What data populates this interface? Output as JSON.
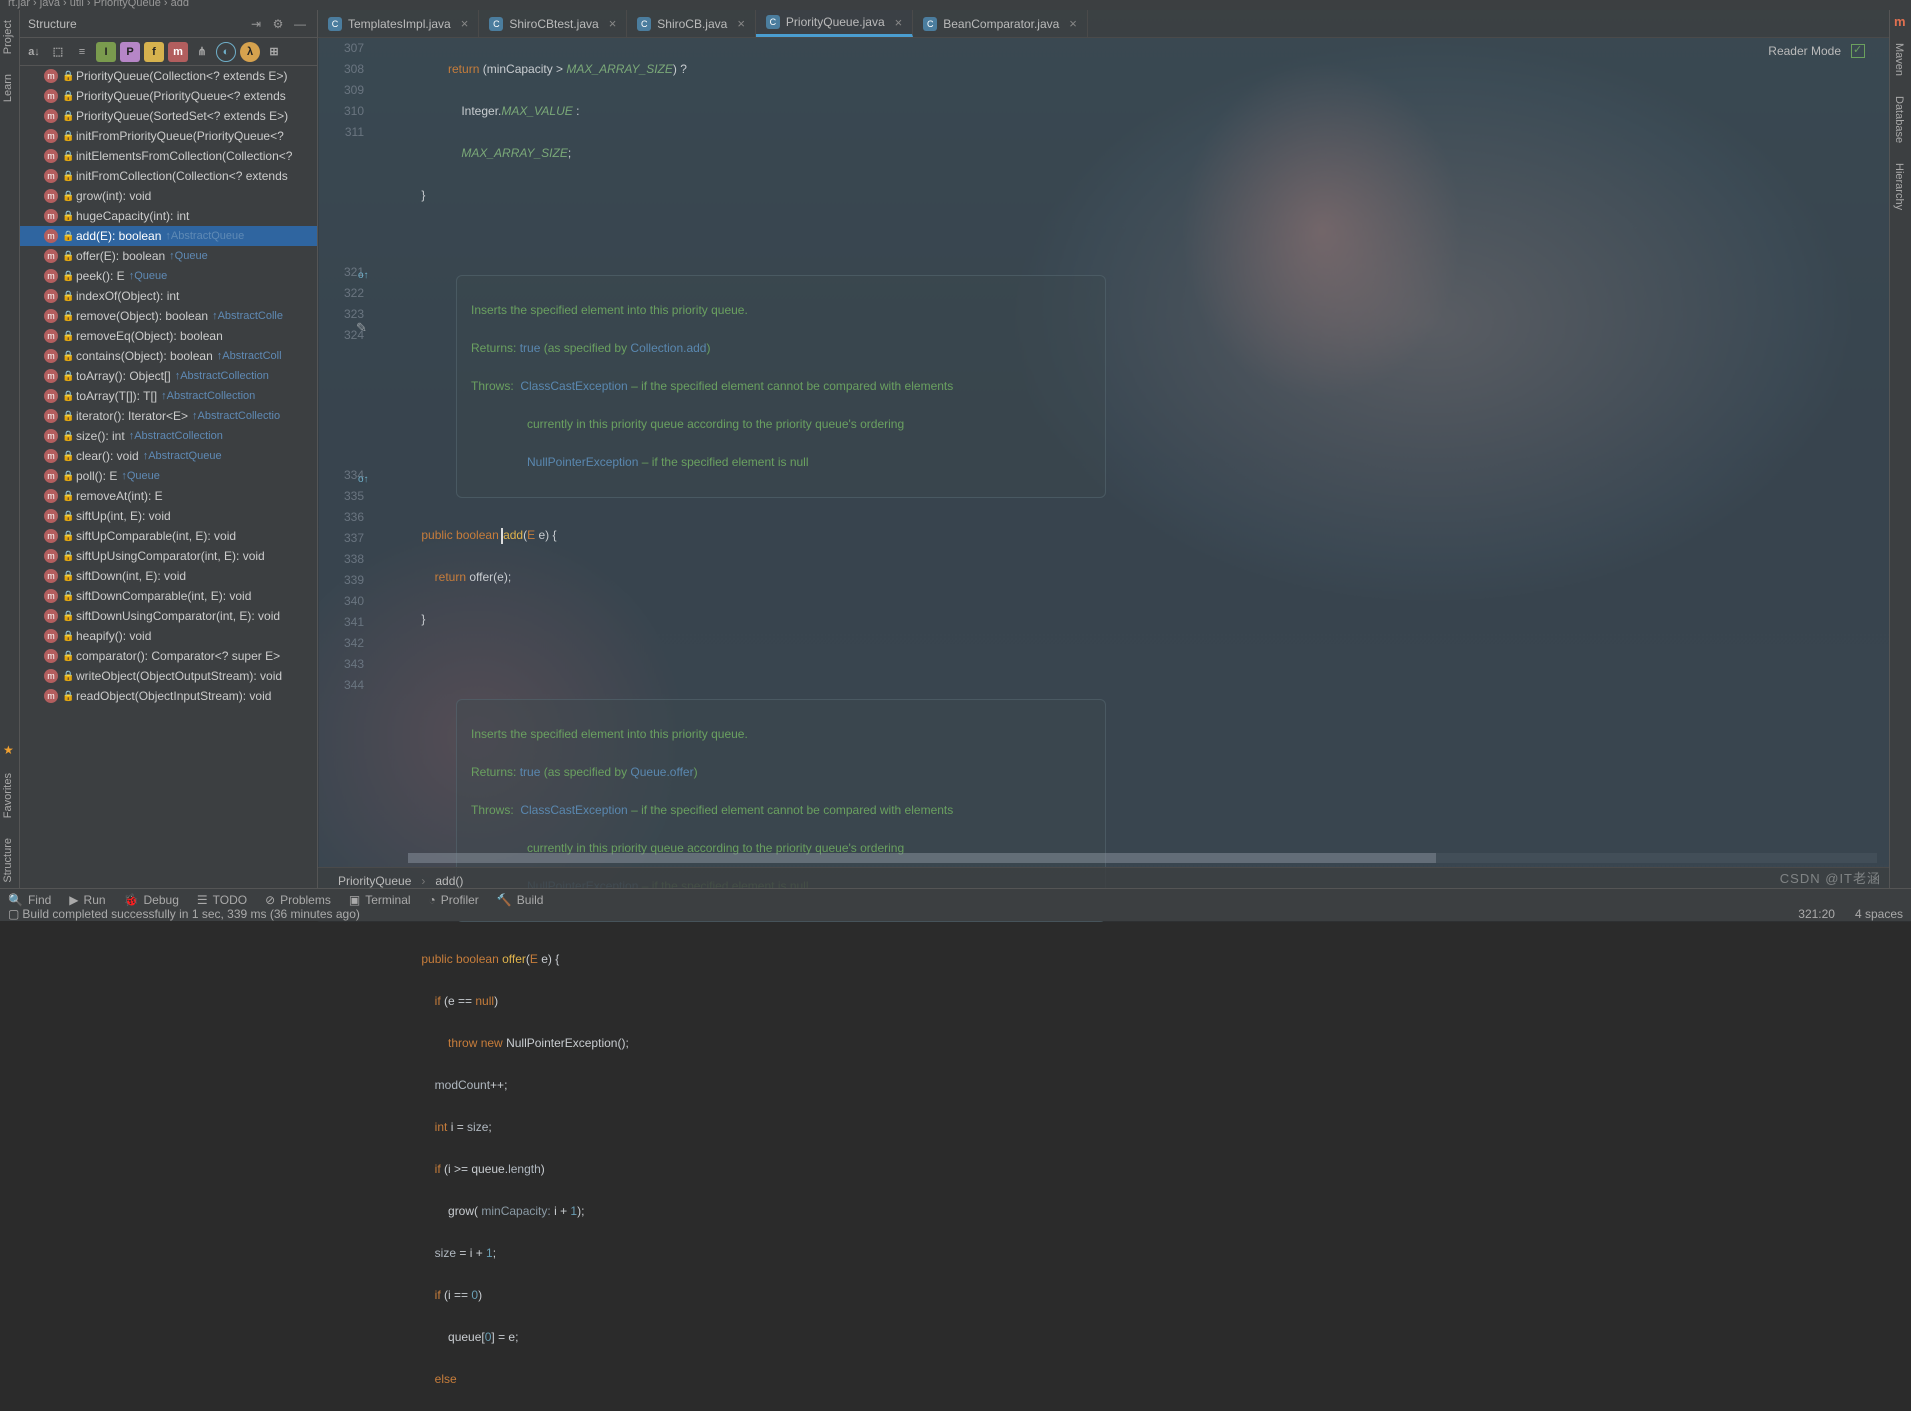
{
  "breadcrumb_top": "rt.jar › java › util › PriorityQueue › add",
  "structure_title": "Structure",
  "left_rail": {
    "project": "Project",
    "learn": "Learn",
    "favorites": "Favorites",
    "structure": "Structure"
  },
  "right_rail": {
    "maven": "Maven",
    "database": "Database",
    "hierarchy": "Hierarchy"
  },
  "tabs": [
    {
      "label": "TemplatesImpl.java",
      "kind": "class"
    },
    {
      "label": "ShiroCBtest.java",
      "kind": "class"
    },
    {
      "label": "ShiroCB.java",
      "kind": "class"
    },
    {
      "label": "PriorityQueue.java",
      "kind": "class",
      "active": true
    },
    {
      "label": "BeanComparator.java",
      "kind": "class"
    }
  ],
  "reader_mode": "Reader Mode",
  "tree": [
    {
      "t": "PriorityQueue(Collection<? extends E>)",
      "lock": true
    },
    {
      "t": "PriorityQueue(PriorityQueue<? extends",
      "lock": true
    },
    {
      "t": "PriorityQueue(SortedSet<? extends E>)",
      "lock": true
    },
    {
      "t": "initFromPriorityQueue(PriorityQueue<?",
      "lock": true
    },
    {
      "t": "initElementsFromCollection(Collection<?",
      "lock": true
    },
    {
      "t": "initFromCollection(Collection<? extends",
      "lock": true
    },
    {
      "t": "grow(int): void",
      "lock": true
    },
    {
      "t": "hugeCapacity(int): int",
      "lock": true
    },
    {
      "t": "add(E): boolean",
      "lock": true,
      "ovr": "↑AbstractQueue",
      "sel": true
    },
    {
      "t": "offer(E): boolean",
      "lock": true,
      "ovr": "↑Queue"
    },
    {
      "t": "peek(): E",
      "lock": true,
      "ovr": "↑Queue"
    },
    {
      "t": "indexOf(Object): int",
      "lock": true
    },
    {
      "t": "remove(Object): boolean",
      "lock": true,
      "ovr": "↑AbstractColle"
    },
    {
      "t": "removeEq(Object): boolean",
      "lock": true
    },
    {
      "t": "contains(Object): boolean",
      "lock": true,
      "ovr": "↑AbstractColl"
    },
    {
      "t": "toArray(): Object[]",
      "lock": true,
      "ovr": "↑AbstractCollection"
    },
    {
      "t": "toArray(T[]): T[]",
      "lock": true,
      "ovr": "↑AbstractCollection"
    },
    {
      "t": "iterator(): Iterator<E>",
      "lock": true,
      "ovr": "↑AbstractCollectio"
    },
    {
      "t": "size(): int",
      "lock": true,
      "ovr": "↑AbstractCollection"
    },
    {
      "t": "clear(): void",
      "lock": true,
      "ovr": "↑AbstractQueue"
    },
    {
      "t": "poll(): E",
      "lock": true,
      "ovr": "↑Queue"
    },
    {
      "t": "removeAt(int): E",
      "lock": true
    },
    {
      "t": "siftUp(int, E): void",
      "lock": true
    },
    {
      "t": "siftUpComparable(int, E): void",
      "lock": true
    },
    {
      "t": "siftUpUsingComparator(int, E): void",
      "lock": true
    },
    {
      "t": "siftDown(int, E): void",
      "lock": true
    },
    {
      "t": "siftDownComparable(int, E): void",
      "lock": true
    },
    {
      "t": "siftDownUsingComparator(int, E): void",
      "lock": true
    },
    {
      "t": "heapify(): void",
      "lock": true
    },
    {
      "t": "comparator(): Comparator<? super E>",
      "lock": true
    },
    {
      "t": "writeObject(ObjectOutputStream): void",
      "lock": true
    },
    {
      "t": "readObject(ObjectInputStream): void",
      "lock": true
    }
  ],
  "line_numbers": [
    "307",
    "308",
    "309",
    "310",
    "311",
    "",
    "",
    "",
    "",
    "",
    "",
    "321",
    "322",
    "323",
    "324",
    "",
    "",
    "",
    "",
    "",
    "",
    "334",
    "335",
    "336",
    "337",
    "338",
    "339",
    "340",
    "341",
    "342",
    "343",
    "344",
    ""
  ],
  "doc1": {
    "l1": "Inserts the specified element into this priority queue.",
    "ret": "Returns: ",
    "ret_v": "true",
    "ret_t": " (as specified by ",
    "ret_link": "Collection.add",
    "ret_e": ")",
    "thr": "Throws:  ",
    "e1": "ClassCastException",
    "e1t": " – if the specified element cannot be compared with elements",
    "e1t2": "currently in this priority queue according to the priority queue's ordering",
    "e2": "NullPointerException",
    "e2t": " – if the specified element is null"
  },
  "doc2": {
    "l1": "Inserts the specified element into this priority queue.",
    "ret": "Returns: ",
    "ret_v": "true",
    "ret_t": " (as specified by ",
    "ret_link": "Queue.offer",
    "ret_e": ")",
    "thr": "Throws:  ",
    "e1": "ClassCastException",
    "e1t": " – if the specified element cannot be compared with elements",
    "e1t2": "currently in this priority queue according to the priority queue's ordering",
    "e2": "NullPointerException",
    "e2t": " – if the specified element is null"
  },
  "code": {
    "l307a": "return ",
    "l307b": "(minCapacity > ",
    "l307c": "MAX_ARRAY_SIZE",
    "l307d": ") ?",
    "l308a": "Integer.",
    "l308b": "MAX_VALUE",
    "l308c": " :",
    "l309a": "MAX_ARRAY_SIZE",
    "l309b": ";",
    "l310": "}",
    "l321a": "public ",
    "l321b": "boolean ",
    "l321c": "add",
    "l321d": "(",
    "l321e": "E ",
    "l321f": "e) {",
    "l322a": "return ",
    "l322b": "offer(e);",
    "l323": "}",
    "l334a": "public ",
    "l334b": "boolean ",
    "l334c": "offer",
    "l334d": "(",
    "l334e": "E ",
    "l334f": "e) {",
    "l335a": "if ",
    "l335b": "(e == ",
    "l335c": "null",
    "l335d": ")",
    "l336a": "throw ",
    "l336b": "new ",
    "l336c": "NullPointerException();",
    "l337a": "modCount",
    "l337b": "++;",
    "l338a": "int ",
    "l338b": "i = ",
    "l338c": "size",
    "l338d": ";",
    "l339a": "if ",
    "l339b": "(i >= queue.",
    "l339c": "length",
    "l339d": ")",
    "l340a": "grow( ",
    "l340h": "minCapacity: ",
    "l340b": "i + ",
    "l340c": "1",
    "l340d": ");",
    "l341a": "size ",
    "l341b": "= i + ",
    "l341c": "1",
    "l341d": ";",
    "l342a": "if ",
    "l342b": "(i == ",
    "l342c": "0",
    "l342d": ")",
    "l343a": "queue[",
    "l343b": "0",
    "l343c": "] = e;",
    "l344": "else"
  },
  "bread2": {
    "a": "PriorityQueue",
    "b": "add()"
  },
  "bottom": {
    "find": "Find",
    "run": "Run",
    "debug": "Debug",
    "todo": "TODO",
    "problems": "Problems",
    "terminal": "Terminal",
    "profiler": "Profiler",
    "build": "Build"
  },
  "status": {
    "msg": "Build completed successfully in 1 sec, 339 ms (36 minutes ago)",
    "pos": "321:20",
    "spaces": "4 spaces"
  },
  "watermark": "CSDN @IT老涵"
}
